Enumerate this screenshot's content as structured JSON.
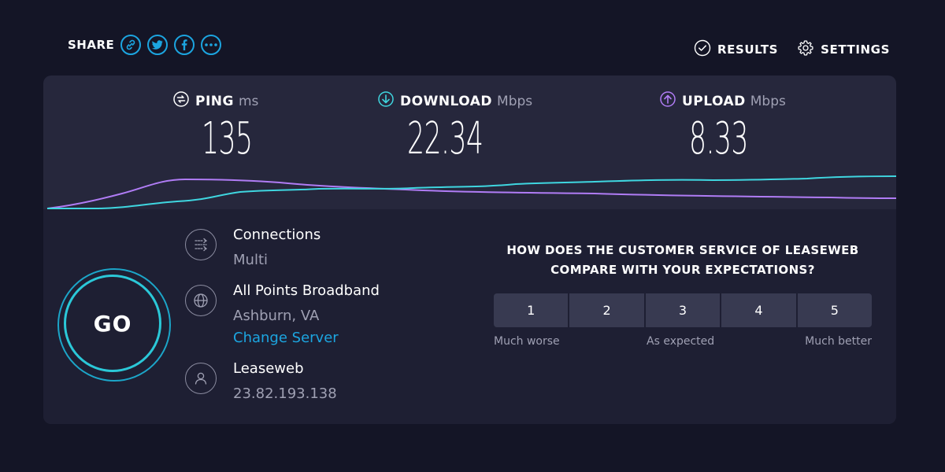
{
  "share": {
    "label": "SHARE",
    "buttons": [
      {
        "icon": "link-icon"
      },
      {
        "icon": "twitter-icon"
      },
      {
        "icon": "facebook-icon"
      },
      {
        "icon": "more-icon"
      }
    ]
  },
  "nav": {
    "results_label": "RESULTS",
    "settings_label": "SETTINGS"
  },
  "metrics": {
    "ping": {
      "name": "PING",
      "unit": "ms",
      "value": "135",
      "color": "#ffffff"
    },
    "download": {
      "name": "DOWNLOAD",
      "unit": "Mbps",
      "value": "22.34",
      "color": "#3fd6e0"
    },
    "upload": {
      "name": "UPLOAD",
      "unit": "Mbps",
      "value": "8.33",
      "color": "#b07cf5"
    }
  },
  "go": {
    "label": "GO"
  },
  "connections": {
    "title": "Connections",
    "value": "Multi"
  },
  "server": {
    "name": "All Points Broadband",
    "location": "Ashburn, VA",
    "change_label": "Change Server"
  },
  "host": {
    "name": "Leaseweb",
    "ip": "23.82.193.138"
  },
  "survey": {
    "question_line1": "HOW DOES THE CUSTOMER SERVICE OF LEASEWEB",
    "question_line2": "COMPARE WITH YOUR EXPECTATIONS?",
    "options": [
      "1",
      "2",
      "3",
      "4",
      "5"
    ],
    "label_low": "Much worse",
    "label_mid": "As expected",
    "label_high": "Much better"
  },
  "colors": {
    "accent": "#1ca5e0",
    "download_line": "#3fd6e0",
    "upload_line": "#b07cf5",
    "card_bg": "#26273c",
    "page_bg": "#141526"
  }
}
